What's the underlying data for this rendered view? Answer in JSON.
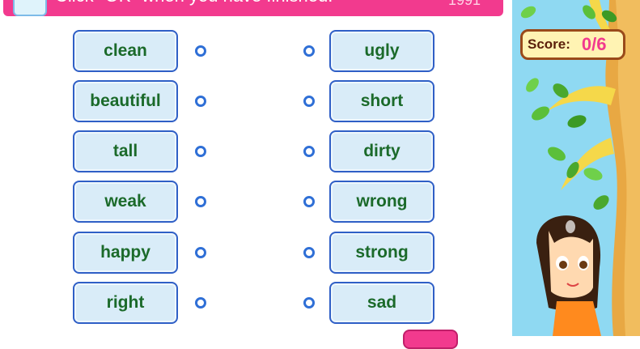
{
  "banner": {
    "instruction": "Click \"OK\" when you have finished.",
    "corner_text": "1991"
  },
  "left_words": [
    "clean",
    "beautiful",
    "tall",
    "weak",
    "happy",
    "right"
  ],
  "right_words": [
    "ugly",
    "short",
    "dirty",
    "wrong",
    "strong",
    "sad"
  ],
  "score": {
    "label": "Score:",
    "value": "0/6"
  },
  "colors": {
    "banner": "#f23a8e",
    "card_fill": "#d9ecf8",
    "card_border": "#2f5fc6",
    "word_text": "#1b6a2a",
    "score_value": "#f23a8e",
    "sky": "#8fd9f2"
  }
}
